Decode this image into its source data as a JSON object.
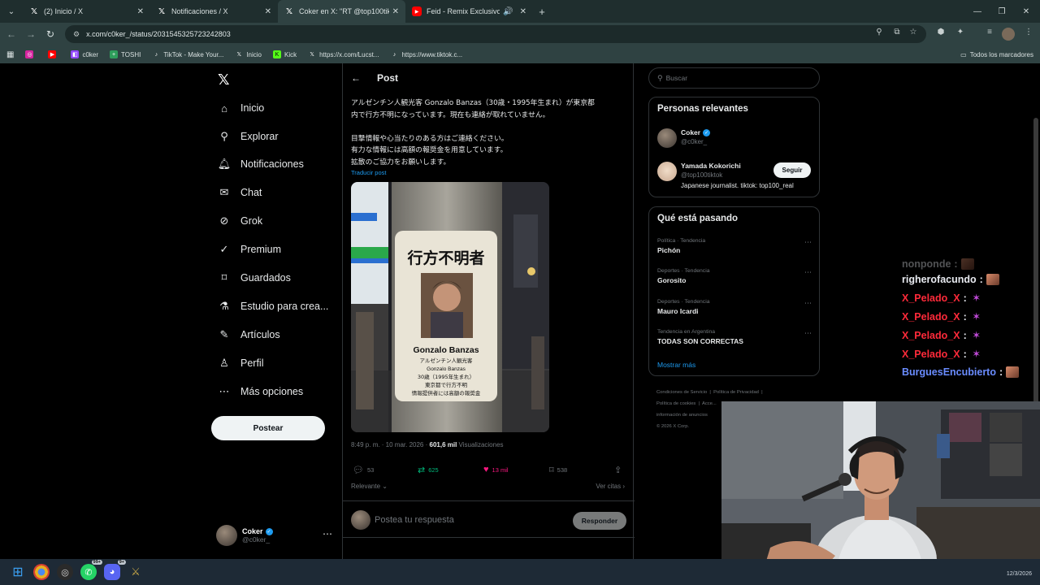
{
  "browser": {
    "tabs": [
      {
        "title": "(2) Inicio / X",
        "icon": "x-icon",
        "active": false
      },
      {
        "title": "Notificaciones / X",
        "icon": "x-icon",
        "active": false
      },
      {
        "title": "Coker en X: \"RT @top100tiktok:",
        "icon": "x-icon",
        "active": true
      },
      {
        "title": "Feid - Remix Exclusivo (Offic",
        "icon": "youtube-icon",
        "active": false
      }
    ],
    "url": "x.com/c0ker_/status/2031545325723242803",
    "bookmarks": [
      {
        "label": "",
        "icon": "instagram-icon",
        "color": "#d6249f"
      },
      {
        "label": "",
        "icon": "youtube-icon",
        "color": "#ff0000"
      },
      {
        "label": "c0ker",
        "icon": "twitch-icon",
        "color": "#9146ff"
      },
      {
        "label": "TOSHI",
        "icon": "plus-icon",
        "color": "#2e9e5b"
      },
      {
        "label": "TikTok - Make Your...",
        "icon": "tiktok-icon",
        "color": "#111111"
      },
      {
        "label": "Inicio",
        "icon": "x-icon",
        "color": "#111111"
      },
      {
        "label": "Kick",
        "icon": "kick-icon",
        "color": "#53fc18"
      },
      {
        "label": "https://x.com/Lucst...",
        "icon": "x-icon",
        "color": "#111111"
      },
      {
        "label": "https://www.tiktok.c...",
        "icon": "tiktok-icon",
        "color": "#111111"
      }
    ],
    "all_bookmarks": "Todos los marcadores"
  },
  "leftnav": {
    "items": [
      {
        "label": "Inicio",
        "icon": "home-icon"
      },
      {
        "label": "Explorar",
        "icon": "search-icon"
      },
      {
        "label": "Notificaciones",
        "icon": "bell-icon"
      },
      {
        "label": "Chat",
        "icon": "mail-icon"
      },
      {
        "label": "Grok",
        "icon": "grok-icon"
      },
      {
        "label": "Premium",
        "icon": "premium-icon"
      },
      {
        "label": "Guardados",
        "icon": "bookmark-icon"
      },
      {
        "label": "Estudio para crea...",
        "icon": "flask-icon"
      },
      {
        "label": "Artículos",
        "icon": "article-icon"
      },
      {
        "label": "Perfil",
        "icon": "person-icon"
      },
      {
        "label": "Más opciones",
        "icon": "more-circle-icon"
      }
    ],
    "post_button": "Postear",
    "account": {
      "name": "Coker",
      "handle": "@c0ker_"
    }
  },
  "post": {
    "header": "Post",
    "text_lines": [
      "アルゼンチン人観光客 Gonzalo Banzas（30歳・1995年生まれ）が東京都",
      "内で行方不明になっています。現在も連絡が取れていません。",
      "目撃情報や心当たりのある方はご連絡ください。",
      "有力な情報には高額の報奨金を用意しています。",
      "拡散のご協力をお願いします。"
    ],
    "translate": "Traducir post",
    "poster": {
      "title": "行方不明者",
      "name": "Gonzalo Banzas",
      "lines": [
        "アルゼンチン人観光客",
        "Gonzalo Banzas",
        "30歳（1995年生まれ）",
        "東京都で行方不明",
        "情報提供者には高額の報奨金"
      ]
    },
    "time": "8:49 p. m. · 10 mar. 2026 · ",
    "views_count": "601,6 mil",
    "views_label": " Visualizaciones",
    "replies": "53",
    "reposts": "625",
    "likes": "13 mil",
    "bookmarks": "538",
    "sort": "Relevante",
    "quotes": "Ver citas",
    "reply_placeholder": "Postea tu respuesta",
    "reply_button": "Responder"
  },
  "sidebar": {
    "search_placeholder": "Buscar",
    "relevant_title": "Personas relevantes",
    "people": [
      {
        "name": "Coker",
        "handle": "@c0ker_",
        "verified": true,
        "bio": ""
      },
      {
        "name": "Yamada Kokorichi",
        "handle": "@top100tiktok",
        "verified": false,
        "bio": "Japanese journalist. tiktok: top100_real",
        "follow": "Seguir"
      }
    ],
    "trends_title": "Qué está pasando",
    "trends": [
      {
        "context": "Política · Tendencia",
        "name": "Pichón"
      },
      {
        "context": "Deportes · Tendencia",
        "name": "Gorosito"
      },
      {
        "context": "Deportes · Tendencia",
        "name": "Mauro Icardi"
      },
      {
        "context": "Tendencia en Argentina",
        "name": "TODAS SON CORRECTAS"
      }
    ],
    "show_more": "Mostrar más",
    "footer": [
      "Condiciones de Servicio",
      "Política de Privacidad",
      "Política de cookies",
      "Acce...",
      "información de anuncios",
      "© 2026 X Corp."
    ]
  },
  "stream_chat": [
    {
      "user": "nonponde",
      "color": "white",
      "emote": "face"
    },
    {
      "user": "righerofacundo",
      "color": "white",
      "emote": "face"
    },
    {
      "user": "X_Pelado_X",
      "color": "red",
      "emote": "purple"
    },
    {
      "user": "X_Pelado_X",
      "color": "red",
      "emote": "purple"
    },
    {
      "user": "X_Pelado_X",
      "color": "red",
      "emote": "purple"
    },
    {
      "user": "X_Pelado_X",
      "color": "red",
      "emote": "purple"
    },
    {
      "user": "BurguesEncubierto",
      "color": "blue",
      "emote": "face"
    }
  ],
  "taskbar": {
    "apps": [
      "windows-icon",
      "chrome-icon",
      "obs-icon",
      "whatsapp-icon",
      "discord-icon",
      "league-icon"
    ],
    "badges": {
      "whatsapp": "99+",
      "discord": "9+"
    },
    "date": "12/3/2026"
  },
  "colors": {
    "accent": "#1d9bf0",
    "like": "#f91880",
    "repost": "#00ba7c",
    "chat_red": "#ff2a3a",
    "chat_blue": "#6a8cff"
  }
}
